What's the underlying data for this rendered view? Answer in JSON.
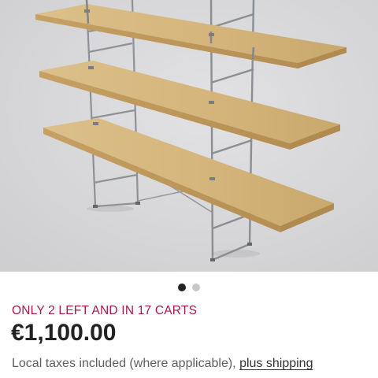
{
  "product_image": {
    "description_icon": "shelving-unit-photo"
  },
  "carousel": {
    "dot_count": 2,
    "active_index": 0
  },
  "listing": {
    "stock_message": "ONLY 2 LEFT AND IN 17 CARTS",
    "price": "€1,100.00",
    "taxes_text": "Local taxes included (where applicable), ",
    "shipping_link": "plus shipping"
  },
  "colors": {
    "stock_accent": "#a61a4a",
    "price_text": "#222222",
    "muted_text": "#5e5e5e",
    "dot_active": "#222222",
    "dot_inactive": "#c8c8c8"
  }
}
